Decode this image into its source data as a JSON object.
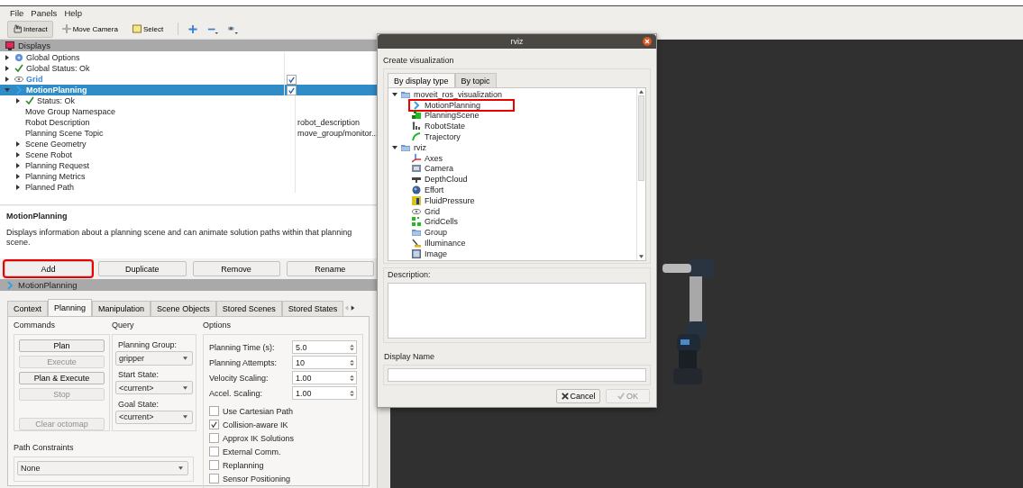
{
  "menu": [
    "File",
    "Panels",
    "Help"
  ],
  "toolbar": {
    "tools": [
      {
        "label": "Interact",
        "kind": "hand",
        "selected": true
      },
      {
        "label": "Move Camera",
        "kind": "move",
        "selected": false
      },
      {
        "label": "Select",
        "kind": "select",
        "selected": false
      }
    ]
  },
  "displays": {
    "title": "Displays",
    "items": [
      {
        "label": "Global Options",
        "kind": "gear",
        "expanded": false,
        "selected": false
      },
      {
        "label": "Global Status: Ok",
        "kind": "check",
        "expanded": false,
        "selected": false
      },
      {
        "label": "Grid",
        "kind": "eye",
        "expanded": false,
        "checked": true,
        "selected": false
      },
      {
        "label": "MotionPlanning",
        "kind": "chevron",
        "expanded": true,
        "checked": true,
        "selected": true,
        "children": [
          {
            "label": "Status: Ok",
            "kind": "check",
            "expanded": false,
            "selected": false
          },
          {
            "label": "Move Group Namespace",
            "selected": false
          },
          {
            "label": "Robot Description",
            "value": "robot_description",
            "selected": false
          },
          {
            "label": "Planning Scene Topic",
            "value": "move_group/monitor...",
            "selected": false
          },
          {
            "label": "Scene Geometry",
            "expanded": false,
            "selected": false
          },
          {
            "label": "Scene Robot",
            "expanded": false,
            "selected": false
          },
          {
            "label": "Planning Request",
            "expanded": false,
            "selected": false
          },
          {
            "label": "Planning Metrics",
            "expanded": false,
            "selected": false
          },
          {
            "label": "Planned Path",
            "expanded": false,
            "selected": false
          }
        ]
      }
    ]
  },
  "description": {
    "title": "MotionPlanning",
    "text": "Displays information about a planning scene and can animate solution paths within that planning scene."
  },
  "display_buttons": [
    {
      "label": "Add",
      "highlighted": true
    },
    {
      "label": "Duplicate",
      "highlighted": false
    },
    {
      "label": "Remove",
      "highlighted": false
    },
    {
      "label": "Rename",
      "highlighted": false
    }
  ],
  "motion_panel": {
    "title": "MotionPlanning",
    "tabs": [
      {
        "label": "Context",
        "selected": false
      },
      {
        "label": "Planning",
        "selected": true
      },
      {
        "label": "Manipulation",
        "selected": false
      },
      {
        "label": "Scene Objects",
        "selected": false
      },
      {
        "label": "Stored Scenes",
        "selected": false
      },
      {
        "label": "Stored States",
        "selected": false
      }
    ],
    "commands": {
      "title": "Commands",
      "buttons": [
        {
          "label": "Plan",
          "disabled": false
        },
        {
          "label": "Execute",
          "disabled": true
        },
        {
          "label": "Plan & Execute",
          "disabled": false
        },
        {
          "label": "Stop",
          "disabled": true
        },
        {
          "label": "Clear octomap",
          "disabled": true
        }
      ]
    },
    "query": {
      "title": "Query",
      "fields": [
        {
          "label": "Planning Group:",
          "value": "gripper"
        },
        {
          "label": "Start State:",
          "value": "<current>"
        },
        {
          "label": "Goal State:",
          "value": "<current>"
        }
      ]
    },
    "options": {
      "title": "Options",
      "spins": [
        {
          "label": "Planning Time (s):",
          "value": "5.0"
        },
        {
          "label": "Planning Attempts:",
          "value": "10"
        },
        {
          "label": "Velocity Scaling:",
          "value": "1.00"
        },
        {
          "label": "Accel. Scaling:",
          "value": "1.00"
        }
      ],
      "checks": [
        {
          "label": "Use Cartesian Path",
          "checked": false
        },
        {
          "label": "Collision-aware IK",
          "checked": true
        },
        {
          "label": "Approx IK Solutions",
          "checked": false
        },
        {
          "label": "External Comm.",
          "checked": false
        },
        {
          "label": "Replanning",
          "checked": false
        },
        {
          "label": "Sensor Positioning",
          "checked": false
        }
      ]
    },
    "path_constraints": {
      "title": "Path Constraints",
      "value": "None"
    }
  },
  "dialog": {
    "title": "rviz",
    "heading": "Create visualization",
    "tabs": [
      {
        "label": "By display type",
        "selected": true
      },
      {
        "label": "By topic",
        "selected": false
      }
    ],
    "tree": [
      {
        "label": "moveit_ros_visualization",
        "kind": "folder",
        "expanded": true,
        "highlighted": false,
        "children": [
          {
            "label": "MotionPlanning",
            "kind": "chevron",
            "highlighted": true
          },
          {
            "label": "PlanningScene",
            "kind": "squares",
            "highlighted": false
          },
          {
            "label": "RobotState",
            "kind": "robot",
            "highlighted": false
          },
          {
            "label": "Trajectory",
            "kind": "arc",
            "highlighted": false
          }
        ]
      },
      {
        "label": "rviz",
        "kind": "folder",
        "expanded": true,
        "highlighted": false,
        "children": [
          {
            "label": "Axes",
            "kind": "axes",
            "highlighted": false
          },
          {
            "label": "Camera",
            "kind": "camera",
            "highlighted": false
          },
          {
            "label": "DepthCloud",
            "kind": "sensor",
            "highlighted": false
          },
          {
            "label": "Effort",
            "kind": "ball",
            "highlighted": false
          },
          {
            "label": "FluidPressure",
            "kind": "gauge",
            "highlighted": false
          },
          {
            "label": "Grid",
            "kind": "eye",
            "highlighted": false
          },
          {
            "label": "GridCells",
            "kind": "cells",
            "highlighted": false
          },
          {
            "label": "Group",
            "kind": "folder",
            "highlighted": false
          },
          {
            "label": "Illuminance",
            "kind": "lamp",
            "highlighted": false
          },
          {
            "label": "Image",
            "kind": "image",
            "highlighted": false
          }
        ]
      }
    ],
    "description_label": "Description:",
    "name_label": "Display Name",
    "buttons": [
      {
        "label": "Cancel",
        "kind": "x",
        "disabled": false
      },
      {
        "label": "OK",
        "kind": "tick",
        "disabled": true
      }
    ]
  }
}
